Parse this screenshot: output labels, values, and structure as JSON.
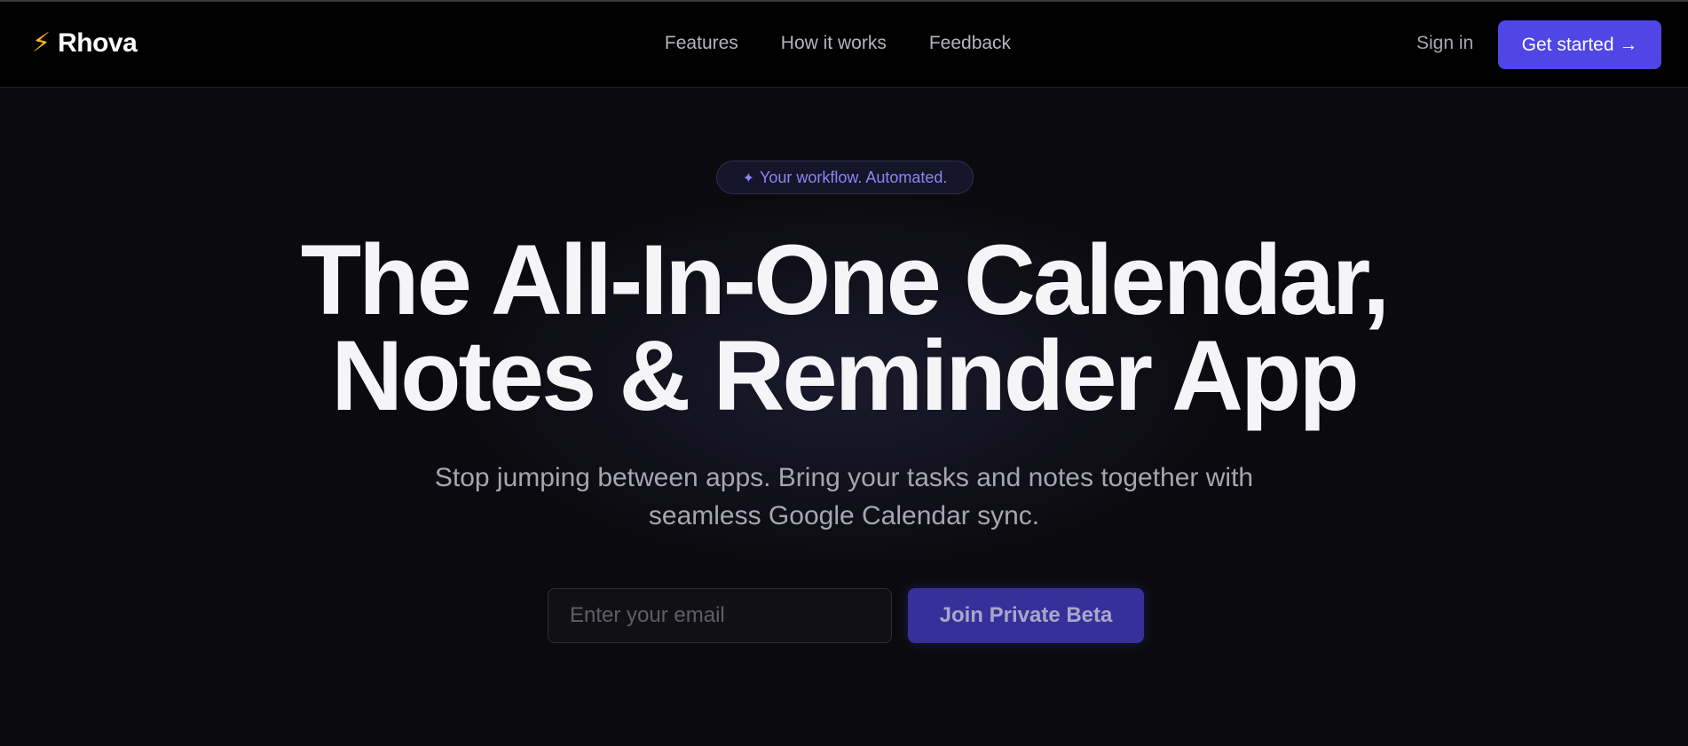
{
  "header": {
    "logo_icon": "lightning-bolt-icon",
    "logo_glyph": "⚡",
    "logo_text": "Rhova",
    "nav": [
      "Features",
      "How it works",
      "Feedback"
    ],
    "signin_label": "Sign in",
    "cta_label": "Get started →"
  },
  "hero": {
    "badge_icon": "sparkle-icon",
    "badge_glyph": "✦",
    "badge_text": "Your workflow. Automated.",
    "title_lines": [
      "The All-In-One Calendar,",
      "Notes & Reminder App"
    ],
    "subtitle_lines": [
      "Stop jumping between apps. Bring your tasks and notes together with",
      "seamless Google Calendar sync."
    ],
    "email_placeholder": "Enter your email",
    "email_value": "",
    "join_label": "Join Private Beta"
  },
  "colors": {
    "accent": "#4f46e5",
    "background": "#0b0b0f",
    "logo_icon": "#f5b324",
    "badge_text": "#8b84f5"
  }
}
